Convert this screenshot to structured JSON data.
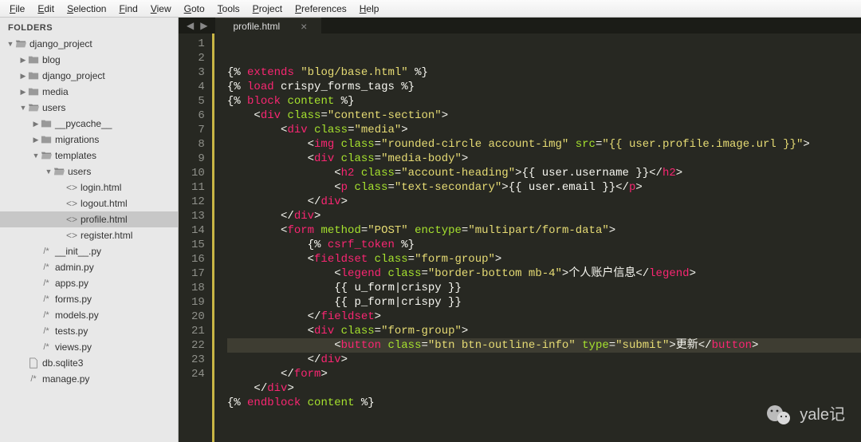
{
  "menubar": [
    "File",
    "Edit",
    "Selection",
    "Find",
    "View",
    "Goto",
    "Tools",
    "Project",
    "Preferences",
    "Help"
  ],
  "sidebar": {
    "header": "FOLDERS",
    "tree": [
      {
        "depth": 0,
        "arrow": "down",
        "icon": "folder-open",
        "label": "django_project"
      },
      {
        "depth": 1,
        "arrow": "right",
        "icon": "folder",
        "label": "blog"
      },
      {
        "depth": 1,
        "arrow": "right",
        "icon": "folder",
        "label": "django_project"
      },
      {
        "depth": 1,
        "arrow": "right",
        "icon": "folder",
        "label": "media"
      },
      {
        "depth": 1,
        "arrow": "down",
        "icon": "folder-open",
        "label": "users"
      },
      {
        "depth": 2,
        "arrow": "right",
        "icon": "folder",
        "label": "__pycache__"
      },
      {
        "depth": 2,
        "arrow": "right",
        "icon": "folder",
        "label": "migrations"
      },
      {
        "depth": 2,
        "arrow": "down",
        "icon": "folder-open",
        "label": "templates"
      },
      {
        "depth": 3,
        "arrow": "down",
        "icon": "folder-open",
        "label": "users"
      },
      {
        "depth": 4,
        "arrow": "",
        "icon": "code",
        "label": "login.html"
      },
      {
        "depth": 4,
        "arrow": "",
        "icon": "code",
        "label": "logout.html"
      },
      {
        "depth": 4,
        "arrow": "",
        "icon": "code",
        "label": "profile.html",
        "selected": true
      },
      {
        "depth": 4,
        "arrow": "",
        "icon": "code",
        "label": "register.html"
      },
      {
        "depth": 2,
        "arrow": "",
        "icon": "py",
        "label": "__init__.py"
      },
      {
        "depth": 2,
        "arrow": "",
        "icon": "py",
        "label": "admin.py"
      },
      {
        "depth": 2,
        "arrow": "",
        "icon": "py",
        "label": "apps.py"
      },
      {
        "depth": 2,
        "arrow": "",
        "icon": "py",
        "label": "forms.py"
      },
      {
        "depth": 2,
        "arrow": "",
        "icon": "py",
        "label": "models.py"
      },
      {
        "depth": 2,
        "arrow": "",
        "icon": "py",
        "label": "tests.py"
      },
      {
        "depth": 2,
        "arrow": "",
        "icon": "py",
        "label": "views.py"
      },
      {
        "depth": 1,
        "arrow": "",
        "icon": "file",
        "label": "db.sqlite3"
      },
      {
        "depth": 1,
        "arrow": "",
        "icon": "py",
        "label": "manage.py"
      }
    ]
  },
  "tab": {
    "title": "profile.html",
    "close": "×"
  },
  "code": {
    "line_count": 24,
    "lines": [
      [
        [
          "w",
          "{% "
        ],
        [
          "t",
          "extends"
        ],
        [
          "w",
          " "
        ],
        [
          "s",
          "\"blog/base.html\""
        ],
        [
          "w",
          " %}"
        ]
      ],
      [
        [
          "w",
          "{% "
        ],
        [
          "t",
          "load"
        ],
        [
          "w",
          " crispy_forms_tags %}"
        ]
      ],
      [
        [
          "w",
          "{% "
        ],
        [
          "t",
          "block"
        ],
        [
          "w",
          " "
        ],
        [
          "a",
          "content"
        ],
        [
          "w",
          " %}"
        ]
      ],
      [
        [
          "w",
          "    <"
        ],
        [
          "t",
          "div"
        ],
        [
          "w",
          " "
        ],
        [
          "a",
          "class"
        ],
        [
          "w",
          "="
        ],
        [
          "s",
          "\"content-section\""
        ],
        [
          "w",
          ">"
        ]
      ],
      [
        [
          "w",
          "        <"
        ],
        [
          "t",
          "div"
        ],
        [
          "w",
          " "
        ],
        [
          "a",
          "class"
        ],
        [
          "w",
          "="
        ],
        [
          "s",
          "\"media\""
        ],
        [
          "w",
          ">"
        ]
      ],
      [
        [
          "w",
          "            <"
        ],
        [
          "t",
          "img"
        ],
        [
          "w",
          " "
        ],
        [
          "a",
          "class"
        ],
        [
          "w",
          "="
        ],
        [
          "s",
          "\"rounded-circle account-img\""
        ],
        [
          "w",
          " "
        ],
        [
          "a",
          "src"
        ],
        [
          "w",
          "="
        ],
        [
          "s",
          "\"{{ user.profile.image.url }}\""
        ],
        [
          "w",
          ">"
        ]
      ],
      [
        [
          "w",
          "            <"
        ],
        [
          "t",
          "div"
        ],
        [
          "w",
          " "
        ],
        [
          "a",
          "class"
        ],
        [
          "w",
          "="
        ],
        [
          "s",
          "\"media-body\""
        ],
        [
          "w",
          ">"
        ]
      ],
      [
        [
          "w",
          "                <"
        ],
        [
          "t",
          "h2"
        ],
        [
          "w",
          " "
        ],
        [
          "a",
          "class"
        ],
        [
          "w",
          "="
        ],
        [
          "s",
          "\"account-heading\""
        ],
        [
          "w",
          ">{{ user.username }}</"
        ],
        [
          "t",
          "h2"
        ],
        [
          "w",
          ">"
        ]
      ],
      [
        [
          "w",
          "                <"
        ],
        [
          "t",
          "p"
        ],
        [
          "w",
          " "
        ],
        [
          "a",
          "class"
        ],
        [
          "w",
          "="
        ],
        [
          "s",
          "\"text-secondary\""
        ],
        [
          "w",
          ">{{ user.email }}</"
        ],
        [
          "t",
          "p"
        ],
        [
          "w",
          ">"
        ]
      ],
      [
        [
          "w",
          "            </"
        ],
        [
          "t",
          "div"
        ],
        [
          "w",
          ">"
        ]
      ],
      [
        [
          "w",
          "        </"
        ],
        [
          "t",
          "div"
        ],
        [
          "w",
          ">"
        ]
      ],
      [
        [
          "w",
          "        <"
        ],
        [
          "t",
          "form"
        ],
        [
          "w",
          " "
        ],
        [
          "a",
          "method"
        ],
        [
          "w",
          "="
        ],
        [
          "s",
          "\"POST\""
        ],
        [
          "w",
          " "
        ],
        [
          "a",
          "enctype"
        ],
        [
          "w",
          "="
        ],
        [
          "s",
          "\"multipart/form-data\""
        ],
        [
          "w",
          ">"
        ]
      ],
      [
        [
          "w",
          "            {% "
        ],
        [
          "t",
          "csrf_token"
        ],
        [
          "w",
          " %}"
        ]
      ],
      [
        [
          "w",
          "            <"
        ],
        [
          "t",
          "fieldset"
        ],
        [
          "w",
          " "
        ],
        [
          "a",
          "class"
        ],
        [
          "w",
          "="
        ],
        [
          "s",
          "\"form-group\""
        ],
        [
          "w",
          ">"
        ]
      ],
      [
        [
          "w",
          "                <"
        ],
        [
          "t",
          "legend"
        ],
        [
          "w",
          " "
        ],
        [
          "a",
          "class"
        ],
        [
          "w",
          "="
        ],
        [
          "s",
          "\"border-bottom mb-4\""
        ],
        [
          "w",
          ">个人账户信息</"
        ],
        [
          "t",
          "legend"
        ],
        [
          "w",
          ">"
        ]
      ],
      [
        [
          "w",
          "                {{ u_form|crispy }}"
        ]
      ],
      [
        [
          "w",
          "                {{ p_form|crispy }}"
        ]
      ],
      [
        [
          "w",
          "            </"
        ],
        [
          "t",
          "fieldset"
        ],
        [
          "w",
          ">"
        ]
      ],
      [
        [
          "w",
          "            <"
        ],
        [
          "t",
          "div"
        ],
        [
          "w",
          " "
        ],
        [
          "a",
          "class"
        ],
        [
          "w",
          "="
        ],
        [
          "s",
          "\"form-group\""
        ],
        [
          "w",
          ">"
        ]
      ],
      [
        [
          "w",
          "                <"
        ],
        [
          "t",
          "button"
        ],
        [
          "w",
          " "
        ],
        [
          "a",
          "class"
        ],
        [
          "w",
          "="
        ],
        [
          "s",
          "\"btn btn-outline-info\""
        ],
        [
          "w",
          " "
        ],
        [
          "a",
          "type"
        ],
        [
          "w",
          "="
        ],
        [
          "s",
          "\"submit\""
        ],
        [
          "w",
          ">更新</"
        ],
        [
          "t",
          "button"
        ],
        [
          "w",
          ">"
        ]
      ],
      [
        [
          "w",
          "            </"
        ],
        [
          "t",
          "div"
        ],
        [
          "w",
          ">"
        ]
      ],
      [
        [
          "w",
          "        </"
        ],
        [
          "t",
          "form"
        ],
        [
          "w",
          ">"
        ]
      ],
      [
        [
          "w",
          "    </"
        ],
        [
          "t",
          "div"
        ],
        [
          "w",
          ">"
        ]
      ],
      [
        [
          "w",
          "{% "
        ],
        [
          "t",
          "endblock"
        ],
        [
          "w",
          " "
        ],
        [
          "a",
          "content"
        ],
        [
          "w",
          " %}"
        ]
      ]
    ],
    "highlighted_line": 20
  },
  "watermark": "yale记"
}
